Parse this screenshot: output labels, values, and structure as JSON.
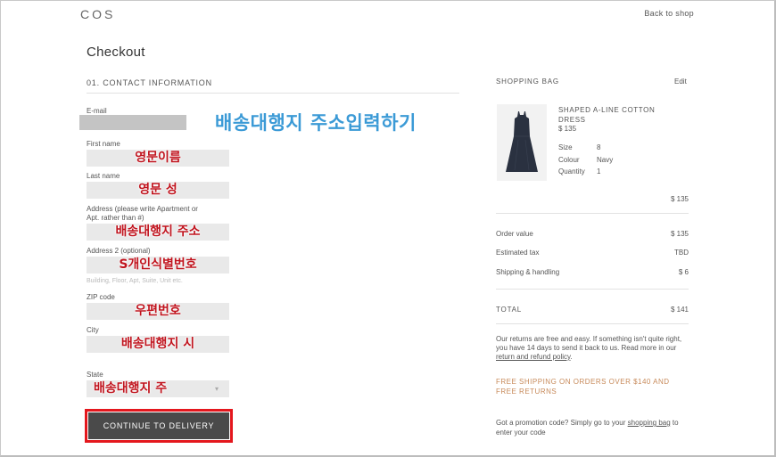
{
  "header": {
    "logo": "COS",
    "back_link": "Back to shop"
  },
  "page_title": "Checkout",
  "contact": {
    "section_title": "01.  CONTACT INFORMATION",
    "email_label": "E-mail",
    "first_name_label": "First name",
    "first_name_value": "영문이름",
    "last_name_label": "Last name",
    "last_name_value": "영문 성",
    "address_label_1": "Address (please write Apartment or",
    "address_label_2": "Apt. rather than #)",
    "address_value": "배송대행지 주소",
    "address2_label": "Address 2 (optional)",
    "address2_value": "S개인식별번호",
    "address2_placeholder": "Building, Floor, Apt, Suite, Unit etc.",
    "zip_label": "ZIP code",
    "zip_value": "우편번호",
    "city_label": "City",
    "city_value": "배송대행지 시",
    "state_label": "State",
    "state_value": "배송대행지 주",
    "continue_label": "CONTINUE TO DELIVERY"
  },
  "overlay_title": "배송대행지 주소입력하기",
  "bag": {
    "title": "SHOPPING BAG",
    "edit_label": "Edit",
    "product_name": "SHAPED A-LINE COTTON DRESS",
    "product_price": "$ 135",
    "size_label": "Size",
    "size_value": "8",
    "colour_label": "Colour",
    "colour_value": "Navy",
    "quantity_label": "Quantity",
    "quantity_value": "1",
    "line_total": "$ 135"
  },
  "summary": {
    "order_value_label": "Order value",
    "order_value": "$ 135",
    "tax_label": "Estimated tax",
    "tax_value": "TBD",
    "shipping_label": "Shipping & handling",
    "shipping_value": "$ 6",
    "total_label": "TOTAL",
    "total_value": "$ 141"
  },
  "returns": {
    "text": "Our returns are free and easy. If something isn't quite right, you have 14 days to send it back to us. Read more in our ",
    "link": "return and refund policy",
    "end": "."
  },
  "free_shipping": "FREE SHIPPING ON ORDERS OVER $140 AND FREE RETURNS",
  "promo": {
    "text": "Got a promotion code? Simply go to your ",
    "link": "shopping bag",
    "end": " to enter your code"
  },
  "colors": {
    "accent_red": "#e4171d",
    "overlay_blue": "#3b9ad6",
    "free_shipping": "#c78a5a",
    "button_bg": "#4a4a4a"
  }
}
